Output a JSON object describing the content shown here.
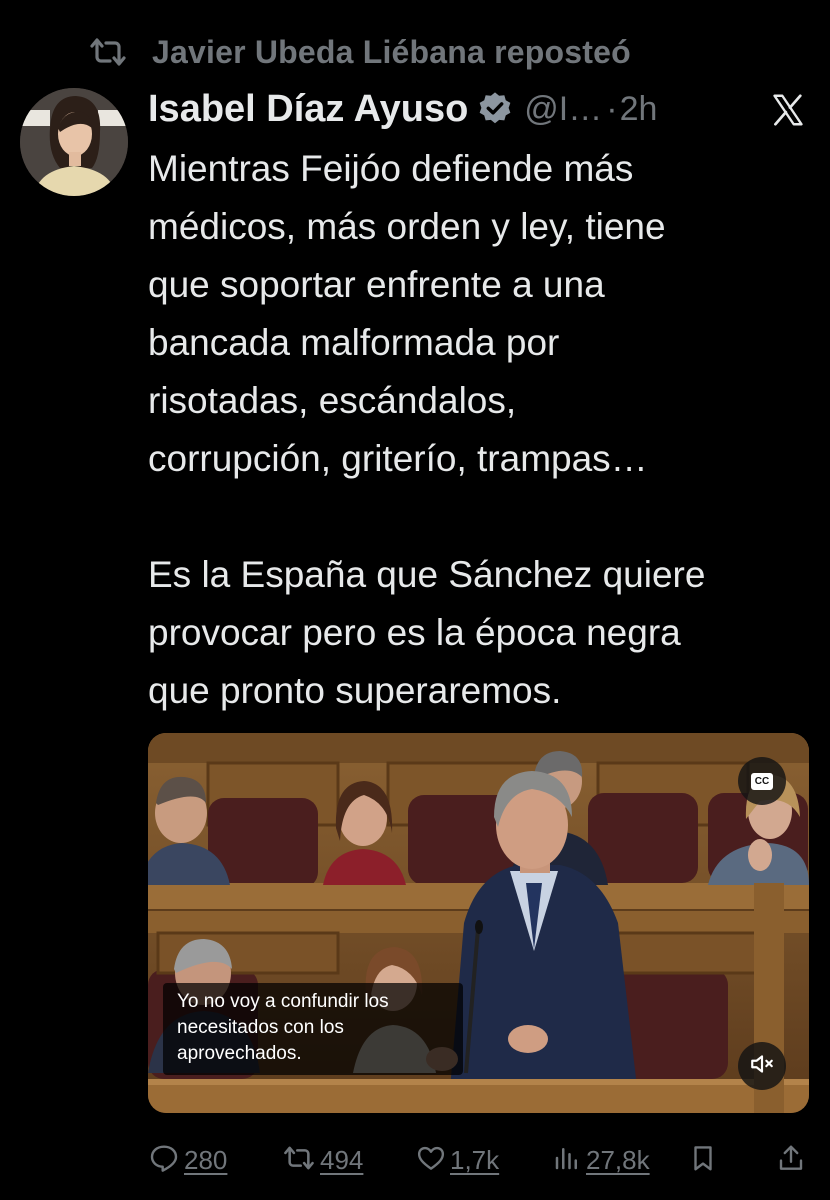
{
  "repost": {
    "label": "Javier Ubeda Liébana reposteó",
    "icon": "repost-icon"
  },
  "author": {
    "name": "Isabel Díaz Ayuso",
    "handle": "@I…",
    "separator": "·",
    "time": "2h",
    "verified_color": "#8c96a0"
  },
  "tweet": {
    "paragraph1": "Mientras Feijóo defiende más\nmédicos, más orden y ley, tiene\nque soportar enfrente a una\nbancada malformada por\nrisotadas, escándalos,\ncorrupción, griterío, trampas…",
    "paragraph2": "Es la España que Sánchez quiere\nprovocar pero es la época negra\nque pronto superaremos."
  },
  "media": {
    "subtitle": "Yo no voy a confundir los\nnecesitados con los\naprovechados.",
    "cc_label": "CC"
  },
  "actions": {
    "replies": "280",
    "reposts": "494",
    "likes": "1,7k",
    "views": "27,8k"
  },
  "colors": {
    "background": "#000000",
    "text": "#e7e9ea",
    "muted": "#71767b"
  }
}
